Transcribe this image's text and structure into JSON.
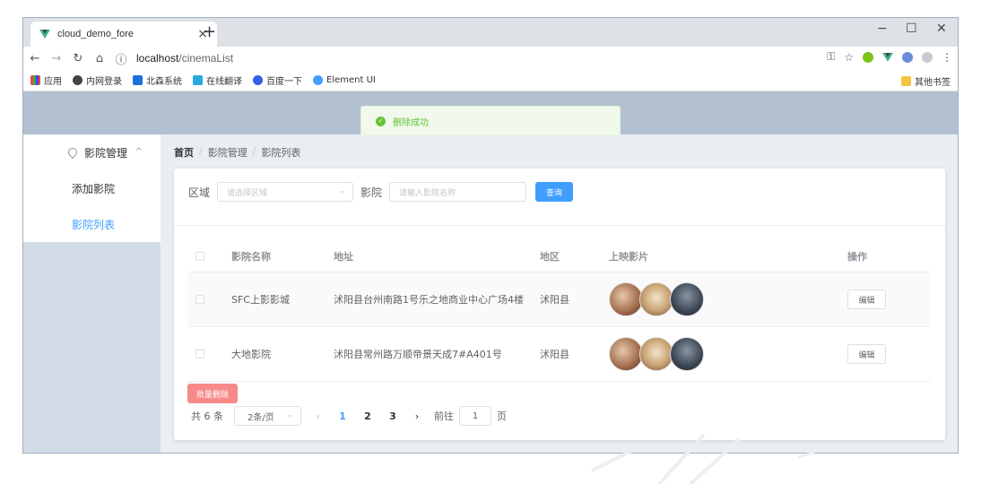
{
  "browser": {
    "tab_title": "cloud_demo_fore",
    "url_host": "localhost",
    "url_path": "/cinemaList",
    "new_tab": "+",
    "tab_close": "×",
    "win_min": "−",
    "win_max": "☐",
    "win_close": "✕",
    "bookmarks": [
      "应用",
      "内网登录",
      "北森系统",
      "在线翻译",
      "百度一下",
      "Element UI"
    ],
    "bookmark_other": "其他书签"
  },
  "toast": {
    "message": "删除成功"
  },
  "sidebar": {
    "group_label": "影院管理",
    "items": [
      {
        "label": "添加影院"
      },
      {
        "label": "影院列表"
      }
    ]
  },
  "breadcrumb": {
    "home": "首页",
    "level1": "影院管理",
    "level2": "影院列表",
    "sep": "/"
  },
  "filter": {
    "region_label": "区域",
    "region_placeholder": "请选择区域",
    "cinema_label": "影院",
    "cinema_placeholder": "请输入影院名称",
    "search_button": "查询"
  },
  "table": {
    "headers": [
      "影院名称",
      "地址",
      "地区",
      "上映影片",
      "操作"
    ],
    "rows": [
      {
        "name": "SFC上影影城",
        "address": "沭阳县台州南路1号乐之地商业中心广场4楼",
        "region": "沭阳县",
        "edit": "编辑"
      },
      {
        "name": "大地影院",
        "address": "沭阳县常州路万顺帝景天成7#A401号",
        "region": "沭阳县",
        "edit": "编辑"
      }
    ]
  },
  "batch_delete": "批量删除",
  "pagination": {
    "total": "共 6 条",
    "page_size": "2条/页",
    "pages": [
      "1",
      "2",
      "3"
    ],
    "current_page": 1,
    "goto_prefix": "前往",
    "goto_value": "1",
    "goto_suffix": "页"
  },
  "colors": {
    "primary": "#409eff",
    "danger": "#f78989",
    "success": "#67c23a",
    "header_bg": "#b3c0d1",
    "sidebar_bg": "#d3dce6"
  }
}
